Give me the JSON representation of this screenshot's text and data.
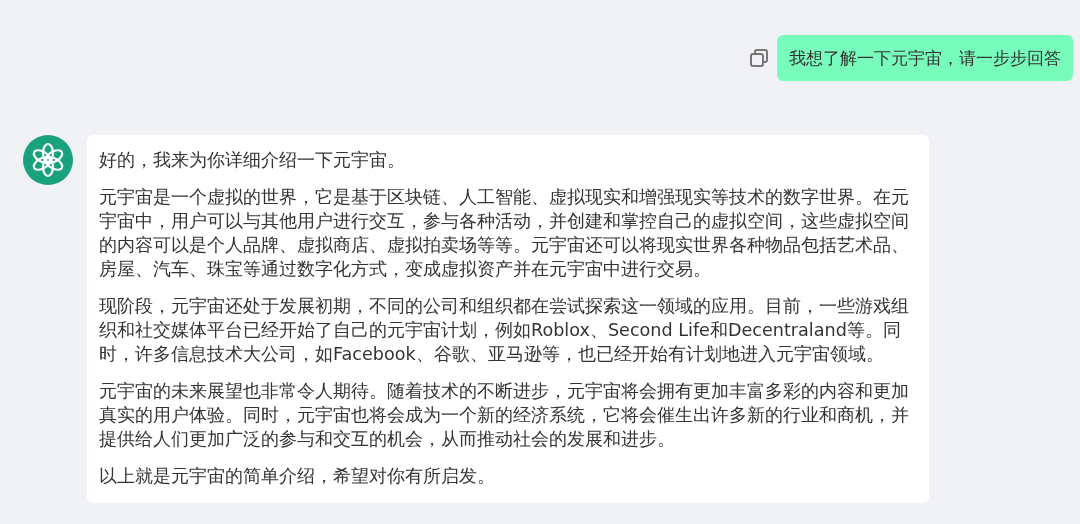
{
  "messages": [
    {
      "kind": "user",
      "text": "我想了解一下元宇宙，请一步步回答"
    },
    {
      "kind": "assistant",
      "paragraphs": [
        "好的，我来为你详细介绍一下元宇宙。",
        "元宇宙是一个虚拟的世界，它是基于区块链、人工智能、虚拟现实和增强现实等技术的数字世界。在元宇宙中，用户可以与其他用户进行交互，参与各种活动，并创建和掌控自己的虚拟空间，这些虚拟空间的内容可以是个人品牌、虚拟商店、虚拟拍卖场等等。元宇宙还可以将现实世界各种物品包括艺术品、房屋、汽车、珠宝等通过数字化方式，变成虚拟资产并在元宇宙中进行交易。",
        "现阶段，元宇宙还处于发展初期，不同的公司和组织都在尝试探索这一领域的应用。目前，一些游戏组织和社交媒体平台已经开始了自己的元宇宙计划，例如Roblox、Second Life和Decentraland等。同时，许多信息技术大公司，如Facebook、谷歌、亚马逊等，也已经开始有计划地进入元宇宙领域。",
        "元宇宙的未来展望也非常令人期待。随着技术的不断进步，元宇宙将会拥有更加丰富多彩的内容和更加真实的用户体验。同时，元宇宙也将会成为一个新的经济系统，它将会催生出许多新的行业和商机，并提供给人们更加广泛的参与和交互的机会，从而推动社会的发展和进步。",
        "以上就是元宇宙的简单介绍，希望对你有所启发。"
      ]
    }
  ]
}
